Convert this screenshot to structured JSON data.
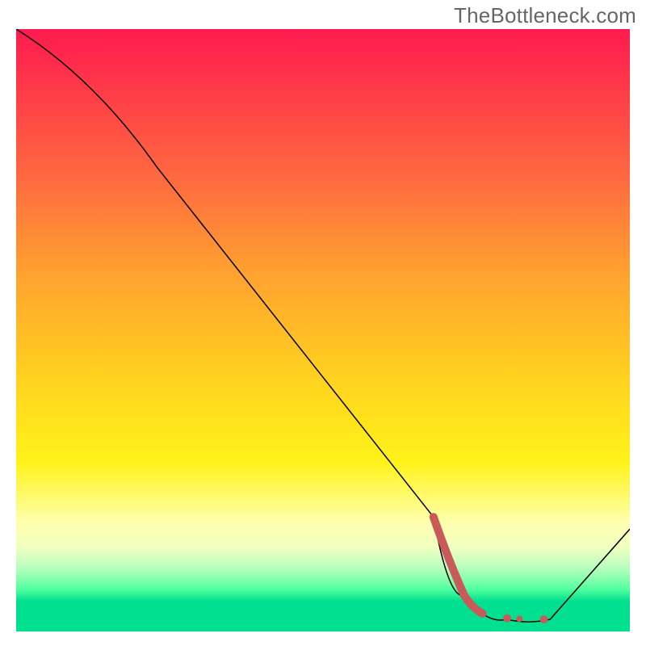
{
  "watermark": "TheBottleneck.com",
  "chart_data": {
    "type": "line",
    "title": "",
    "xlabel": "",
    "ylabel": "",
    "xlim": [
      0,
      100
    ],
    "ylim": [
      0,
      100
    ],
    "curve": [
      {
        "x": 0,
        "y": 100
      },
      {
        "x": 23,
        "y": 77
      },
      {
        "x": 68,
        "y": 19
      },
      {
        "x": 73,
        "y": 6
      },
      {
        "x": 80,
        "y": 2
      },
      {
        "x": 87,
        "y": 2
      },
      {
        "x": 100,
        "y": 17
      }
    ],
    "marker_curve": [
      {
        "x": 68,
        "y": 19
      },
      {
        "x": 73,
        "y": 6
      },
      {
        "x": 76,
        "y": 3
      }
    ],
    "marker_dots": [
      {
        "x": 80,
        "y": 2.2
      },
      {
        "x": 82,
        "y": 2.1
      },
      {
        "x": 86,
        "y": 2
      }
    ],
    "gradient_colors": {
      "top": "#ff1a50",
      "mid": "#ffd21e",
      "bottom": "#00e090"
    }
  }
}
